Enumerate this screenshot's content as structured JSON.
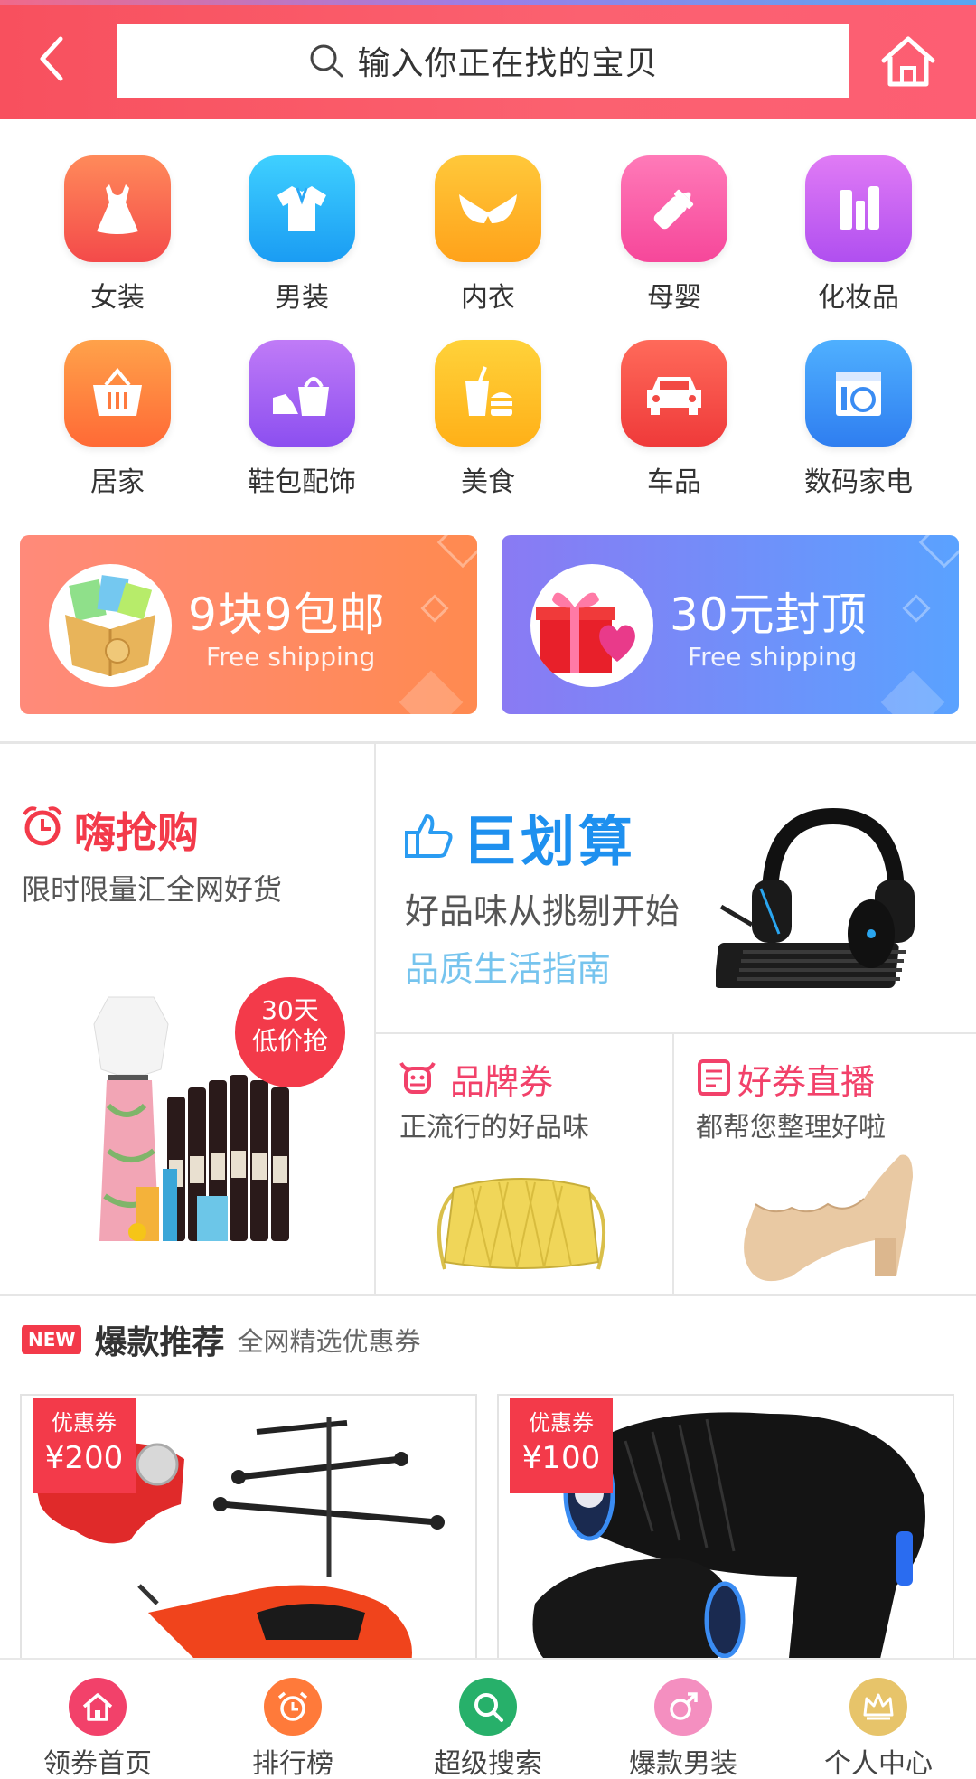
{
  "header": {
    "search_placeholder": "输入你正在找的宝贝",
    "colors": {
      "primary": "#f8505e"
    }
  },
  "categories": [
    {
      "label": "女装",
      "icon": "dress-icon",
      "color_from": "#ff8a5a",
      "color_to": "#f44a4a"
    },
    {
      "label": "男装",
      "icon": "shirt-icon",
      "color_from": "#3fd0ff",
      "color_to": "#1a9cf3"
    },
    {
      "label": "内衣",
      "icon": "bra-icon",
      "color_from": "#ffc83a",
      "color_to": "#ffa21a"
    },
    {
      "label": "母婴",
      "icon": "baby-bottle-icon",
      "color_from": "#ff7ab8",
      "color_to": "#f6479a"
    },
    {
      "label": "化妆品",
      "icon": "cosmetics-icon",
      "color_from": "#e07bf5",
      "color_to": "#b04ff0"
    },
    {
      "label": "居家",
      "icon": "basket-icon",
      "color_from": "#ffa24a",
      "color_to": "#ff6a36"
    },
    {
      "label": "鞋包配饰",
      "icon": "shoe-bag-icon",
      "color_from": "#c07bf7",
      "color_to": "#8c4ff0"
    },
    {
      "label": "美食",
      "icon": "food-icon",
      "color_from": "#ffd23a",
      "color_to": "#ffb018"
    },
    {
      "label": "车品",
      "icon": "car-icon",
      "color_from": "#ff6a5a",
      "color_to": "#ef3a3a"
    },
    {
      "label": "数码家电",
      "icon": "appliance-icon",
      "color_from": "#4fb0ff",
      "color_to": "#2f7ef0"
    }
  ],
  "promos": [
    {
      "title": "9块9包邮",
      "subtitle": "Free shipping"
    },
    {
      "title": "30元封顶",
      "subtitle": "Free shipping"
    }
  ],
  "features": {
    "flash": {
      "title": "嗨抢购",
      "subtitle": "限时限量汇全网好货",
      "badge_line1": "30天",
      "badge_line2": "低价抢"
    },
    "bargain": {
      "title": "巨划算",
      "subtitle": "好品味从挑剔开始",
      "tagline": "品质生活指南"
    },
    "brand": {
      "title": "品牌券",
      "subtitle": "正流行的好品味"
    },
    "live": {
      "title": "好券直播",
      "subtitle": "都帮您整理好啦"
    }
  },
  "hot": {
    "badge": "NEW",
    "title": "爆款推荐",
    "subtitle": "全网精选优惠券",
    "products": [
      {
        "coupon_label": "优惠券",
        "coupon_value": "¥200",
        "image": "toy-helicopter"
      },
      {
        "coupon_label": "优惠券",
        "coupon_value": "¥100",
        "image": "hair-dryer"
      }
    ]
  },
  "nav": [
    {
      "label": "领券首页",
      "icon": "home-icon",
      "color": "#f2416a"
    },
    {
      "label": "排行榜",
      "icon": "alarm-clock-icon",
      "color": "#ff7a3a"
    },
    {
      "label": "超级搜索",
      "icon": "search-icon",
      "color": "#27b06a"
    },
    {
      "label": "爆款男装",
      "icon": "male-icon",
      "color": "#f48fc0"
    },
    {
      "label": "个人中心",
      "icon": "crown-icon",
      "color": "#e7c46a"
    }
  ]
}
